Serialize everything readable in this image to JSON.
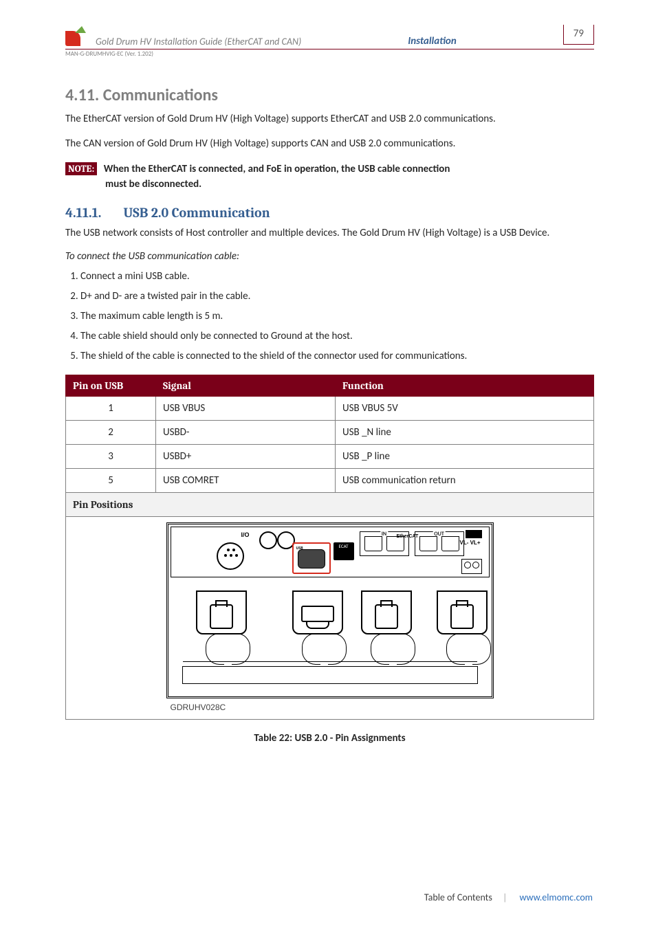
{
  "header": {
    "guide_title": "Gold Drum HV Installation Guide (EtherCAT and CAN)",
    "section_label": "Installation",
    "page_number": "79",
    "doc_code": "MAN-G-DRUMHVIG-EC (Ver. 1.202)"
  },
  "section": {
    "number_title": "4.11.  Communications",
    "para1": "The EtherCAT version of Gold Drum HV (High Voltage) supports EtherCAT and USB 2.0 communications.",
    "para2": "The CAN version of Gold Drum HV (High Voltage) supports CAN and USB 2.0 communications.",
    "note_tag": "NOTE:",
    "note_line1": "When the EtherCAT is connected, and FoE in operation, the USB cable connection",
    "note_line2": "must be disconnected."
  },
  "subsection": {
    "number": "4.11.1.",
    "title": "USB 2.0 Communication",
    "para": "The USB network consists of Host controller and multiple devices. The Gold Drum HV (High Voltage) is a USB Device.",
    "italic": "To connect the USB communication cable:",
    "steps": [
      "Connect a mini USB cable.",
      "D+ and D- are a twisted pair in the cable.",
      "The maximum cable length is 5 m.",
      "The cable shield should only be connected to Ground at the host.",
      "The shield of the cable is connected to the shield of the connector used for communications."
    ]
  },
  "table": {
    "headers": {
      "c1": "Pin on USB",
      "c2": "Signal",
      "c3": "Function"
    },
    "rows": [
      {
        "pin": "1",
        "signal": "USB VBUS",
        "func": "USB VBUS 5V"
      },
      {
        "pin": "2",
        "signal": "USBD-",
        "func": "USB _N line"
      },
      {
        "pin": "3",
        "signal": "USBD+",
        "func": "USB _P line"
      },
      {
        "pin": "5",
        "signal": "USB COMRET",
        "func": "USB communication return"
      }
    ],
    "pin_positions_label": "Pin Positions",
    "figure_labels": {
      "io": "I/O",
      "usb": "USB",
      "ecat": "ECAT",
      "in": "IN",
      "ethercat": "EtherCAT",
      "out": "OUT",
      "vl": "VL- VL+"
    },
    "figure_id": "GDRUHV028C",
    "caption": "Table 22: USB 2.0 - Pin Assignments"
  },
  "footer": {
    "toc": "Table of Contents",
    "url": "www.elmomc.com"
  }
}
